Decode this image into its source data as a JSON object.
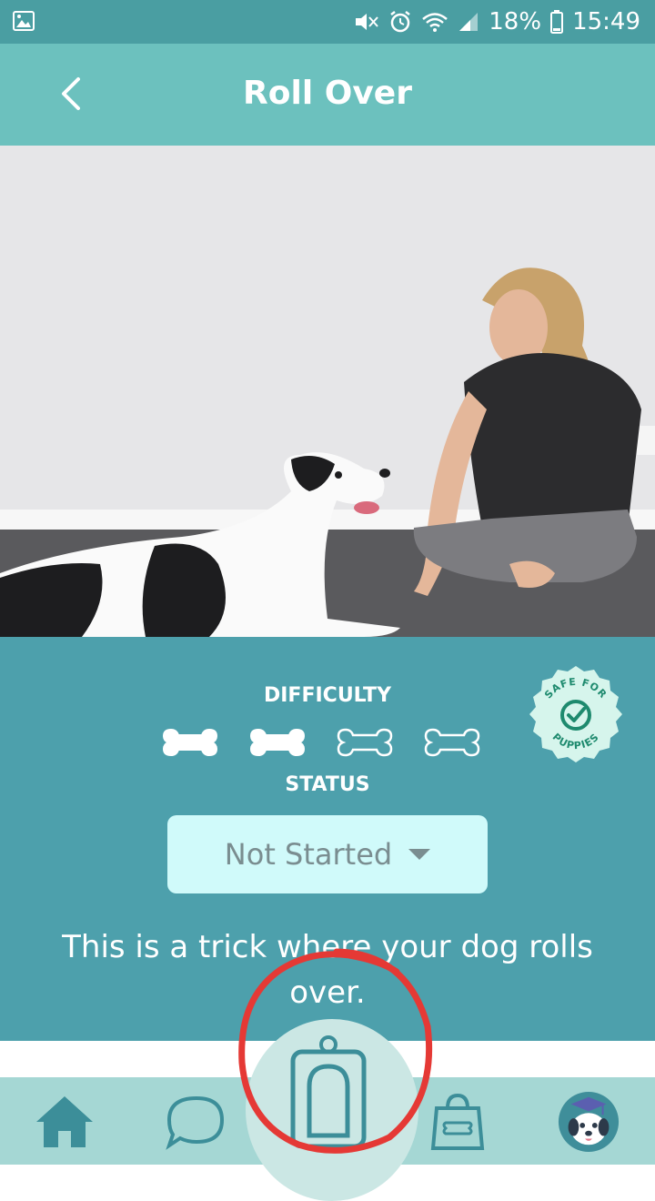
{
  "status_bar": {
    "battery": "18%",
    "time": "15:49"
  },
  "header": {
    "title": "Roll Over"
  },
  "trick": {
    "difficulty_label": "DIFFICULTY",
    "difficulty_level": 2,
    "difficulty_max": 4,
    "status_label": "STATUS",
    "status_value": "Not Started",
    "badge_text_top": "SAFE FOR",
    "badge_text_bottom": "PUPPIES",
    "description": "This is a trick where your dog rolls over."
  },
  "bottom_nav": {
    "items": [
      "home-icon",
      "chat-icon",
      "clicker-icon",
      "shop-bag-icon",
      "profile-dog-icon"
    ]
  },
  "colors": {
    "status_bar": "#4a9ea2",
    "app_bar": "#6cc1be",
    "info_panel": "#4da0ac",
    "select_bg": "#d0fafa",
    "nav_bg": "#a5d7d4",
    "annotation_red": "#e53935"
  }
}
